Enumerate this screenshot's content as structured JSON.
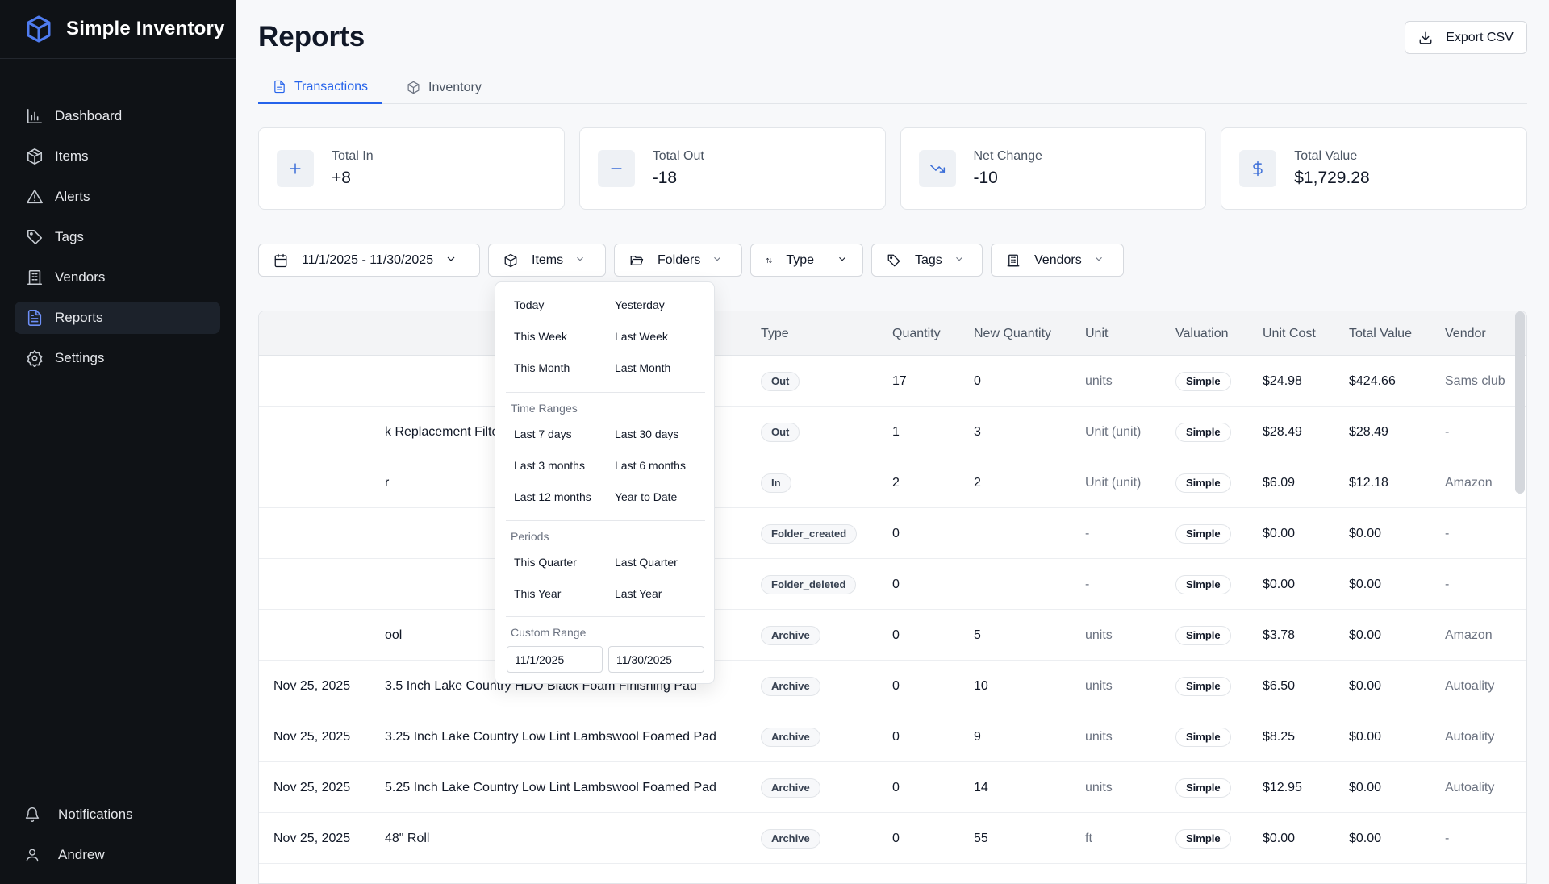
{
  "app": {
    "name": "Simple Inventory"
  },
  "sidebar": {
    "items": [
      {
        "label": "Dashboard",
        "icon": "bar-chart-icon"
      },
      {
        "label": "Items",
        "icon": "box-icon"
      },
      {
        "label": "Alerts",
        "icon": "alert-triangle-icon"
      },
      {
        "label": "Tags",
        "icon": "tag-icon"
      },
      {
        "label": "Vendors",
        "icon": "building-icon"
      },
      {
        "label": "Reports",
        "icon": "file-text-icon",
        "active": true
      },
      {
        "label": "Settings",
        "icon": "gear-icon"
      }
    ],
    "footer": [
      {
        "label": "Notifications",
        "icon": "bell-icon"
      },
      {
        "label": "Andrew",
        "icon": "user-icon"
      }
    ]
  },
  "page": {
    "title": "Reports",
    "export_label": "Export CSV"
  },
  "tabs": [
    {
      "label": "Transactions",
      "active": true
    },
    {
      "label": "Inventory",
      "active": false
    }
  ],
  "stats": [
    {
      "label": "Total In",
      "value": "+8",
      "icon": "plus-icon"
    },
    {
      "label": "Total Out",
      "value": "-18",
      "icon": "minus-icon"
    },
    {
      "label": "Net Change",
      "value": "-10",
      "icon": "trending-down-icon"
    },
    {
      "label": "Total Value",
      "value": "$1,729.28",
      "icon": "dollar-icon"
    }
  ],
  "filters": {
    "date_range": "11/1/2025 - 11/30/2025",
    "items": "Items",
    "folders": "Folders",
    "type": "Type",
    "tags": "Tags",
    "vendors": "Vendors"
  },
  "date_dropdown": {
    "quick": [
      [
        "Today",
        "Yesterday"
      ],
      [
        "This Week",
        "Last Week"
      ],
      [
        "This Month",
        "Last Month"
      ]
    ],
    "time_ranges_label": "Time Ranges",
    "time_ranges": [
      [
        "Last 7 days",
        "Last 30 days"
      ],
      [
        "Last 3 months",
        "Last 6 months"
      ],
      [
        "Last 12 months",
        "Year to Date"
      ]
    ],
    "periods_label": "Periods",
    "periods": [
      [
        "This Quarter",
        "Last Quarter"
      ],
      [
        "This Year",
        "Last Year"
      ]
    ],
    "custom_label": "Custom Range",
    "custom_start": "11/1/2025",
    "custom_end": "11/30/2025"
  },
  "table": {
    "columns": [
      "Type",
      "Quantity",
      "New Quantity",
      "Unit",
      "Valuation",
      "Unit Cost",
      "Total Value",
      "Vendor"
    ],
    "rows": [
      {
        "date": "",
        "item": "",
        "type": "Out",
        "qty": "17",
        "new_qty": "0",
        "unit": "units",
        "valuation": "Simple",
        "unit_cost": "$24.98",
        "total": "$424.66",
        "vendor": "Sams club"
      },
      {
        "date": "",
        "item": "k Replacement Filter",
        "type": "Out",
        "qty": "1",
        "new_qty": "3",
        "unit": "Unit (unit)",
        "valuation": "Simple",
        "unit_cost": "$28.49",
        "total": "$28.49",
        "vendor": "-"
      },
      {
        "date": "",
        "item": "r",
        "type": "In",
        "qty": "2",
        "new_qty": "2",
        "unit": "Unit (unit)",
        "valuation": "Simple",
        "unit_cost": "$6.09",
        "total": "$12.18",
        "vendor": "Amazon"
      },
      {
        "date": "",
        "item": "",
        "type": "Folder_created",
        "qty": "0",
        "new_qty": "",
        "unit": "-",
        "valuation": "Simple",
        "unit_cost": "$0.00",
        "total": "$0.00",
        "vendor": "-"
      },
      {
        "date": "",
        "item": "",
        "type": "Folder_deleted",
        "qty": "0",
        "new_qty": "",
        "unit": "-",
        "valuation": "Simple",
        "unit_cost": "$0.00",
        "total": "$0.00",
        "vendor": "-"
      },
      {
        "date": "",
        "item": "ool",
        "type": "Archive",
        "qty": "0",
        "new_qty": "5",
        "unit": "units",
        "valuation": "Simple",
        "unit_cost": "$3.78",
        "total": "$0.00",
        "vendor": "Amazon"
      },
      {
        "date": "Nov 25, 2025",
        "item": "3.5 Inch Lake Country HDO Black Foam Finishing Pad",
        "type": "Archive",
        "qty": "0",
        "new_qty": "10",
        "unit": "units",
        "valuation": "Simple",
        "unit_cost": "$6.50",
        "total": "$0.00",
        "vendor": "Autoality"
      },
      {
        "date": "Nov 25, 2025",
        "item": "3.25 Inch Lake Country Low Lint Lambswool Foamed Pad",
        "type": "Archive",
        "qty": "0",
        "new_qty": "9",
        "unit": "units",
        "valuation": "Simple",
        "unit_cost": "$8.25",
        "total": "$0.00",
        "vendor": "Autoality"
      },
      {
        "date": "Nov 25, 2025",
        "item": "5.25 Inch Lake Country Low Lint Lambswool Foamed Pad",
        "type": "Archive",
        "qty": "0",
        "new_qty": "14",
        "unit": "units",
        "valuation": "Simple",
        "unit_cost": "$12.95",
        "total": "$0.00",
        "vendor": "Autoality"
      },
      {
        "date": "Nov 25, 2025",
        "item": "48\" Roll",
        "type": "Archive",
        "qty": "0",
        "new_qty": "55",
        "unit": "ft",
        "valuation": "Simple",
        "unit_cost": "$0.00",
        "total": "$0.00",
        "vendor": "-"
      }
    ]
  },
  "colors": {
    "accent": "#2563eb",
    "sidebar_bg": "#0f1216",
    "page_bg": "#f7f8fa"
  }
}
